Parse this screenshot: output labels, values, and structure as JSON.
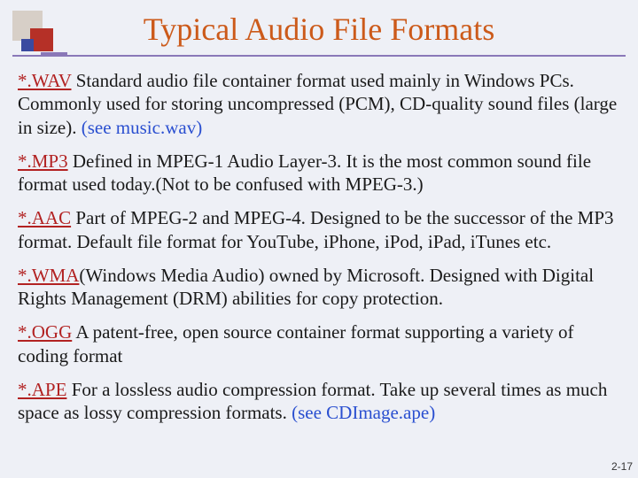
{
  "title": "Typical Audio File Formats",
  "items": [
    {
      "ext": "*.WAV",
      "desc": " Standard audio file container format used mainly in Windows PCs. Commonly used for storing uncompressed (PCM), CD-quality sound files (large in size).      ",
      "link": "(see music.wav)"
    },
    {
      "ext": "*.MP3",
      "desc": " Defined in MPEG-1 Audio Layer-3. It is the most common sound file format used today.(Not to be confused with MPEG-3.)",
      "link": ""
    },
    {
      "ext": "*.AAC",
      "desc": " Part of MPEG-2 and MPEG-4. Designed to be the successor of the MP3 format. Default file format for YouTube, iPhone, iPod, iPad, iTunes etc.",
      "link": ""
    },
    {
      "ext": "*.WMA",
      "desc": "(Windows Media Audio) owned by Microsoft. Designed with Digital Rights Management (DRM) abilities for copy protection.",
      "link": ""
    },
    {
      "ext": "*.OGG",
      "desc": " A patent-free, open source container format supporting a variety of coding format",
      "link": ""
    },
    {
      "ext": "*.APE",
      "desc": " For a lossless audio compression format. Take up several times as much space as lossy compression formats. ",
      "link": "(see CDImage.ape)"
    }
  ],
  "pagenum": "2-17"
}
